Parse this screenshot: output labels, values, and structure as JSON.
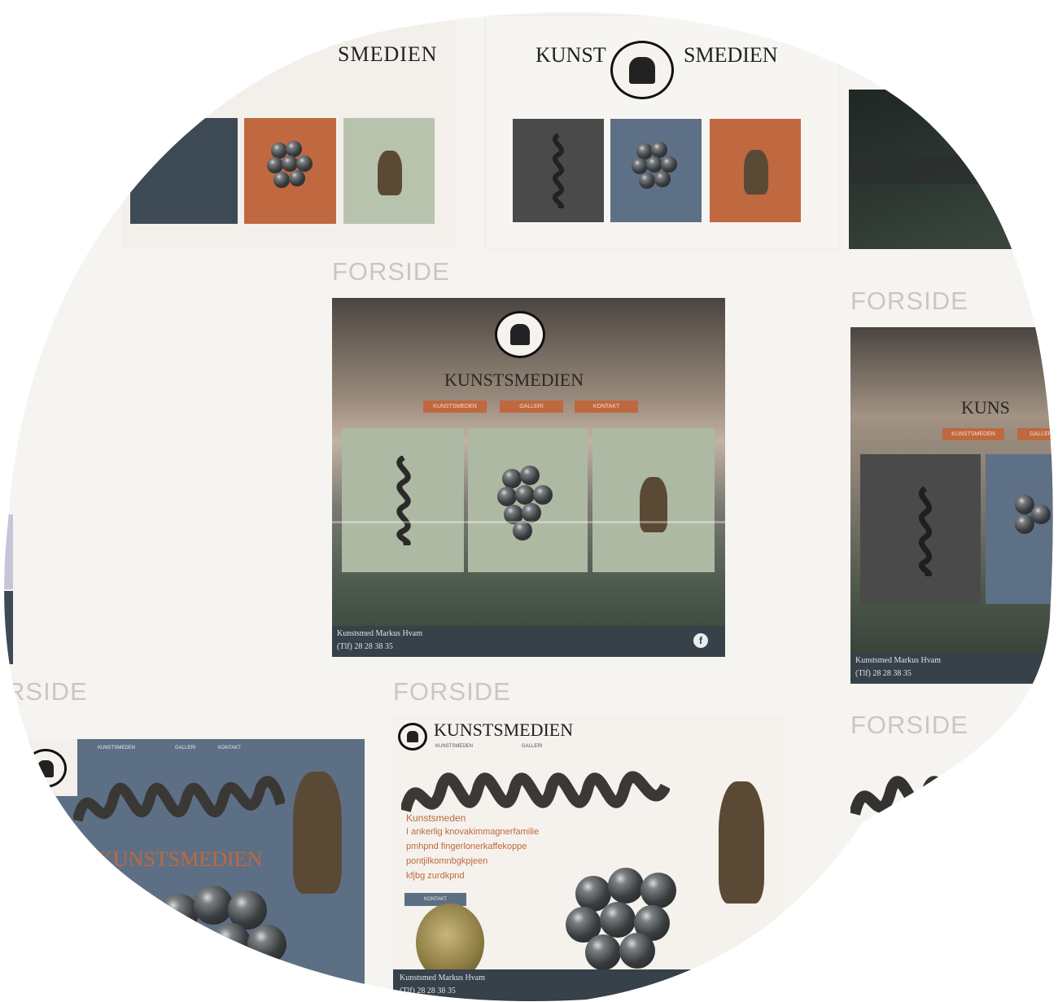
{
  "brand": {
    "name": "KUNSTSMEDIEN",
    "split_left": "KUNST",
    "split_right": "SMEDIEN",
    "partial_top_left": "SMEDIEN",
    "partial_right": "KUNS"
  },
  "labels": {
    "forside": "FORSIDE",
    "forside_cut_left": "RSIDE"
  },
  "main_mockup": {
    "buttons": [
      "KUNSTSMEDEN",
      "GALLERI",
      "KONTAKT"
    ],
    "footer_name": "Kunstsmed Markus Hvam",
    "footer_phone": "(Tlf) 28 28 38 35",
    "social_icon": "facebook-icon"
  },
  "right_mockup": {
    "footer_name": "Kunstsmed Markus Hvam",
    "footer_phone": "(Tlf) 28 28 38 35"
  },
  "bottom_left_mockup": {
    "nav": [
      "KUNSTSMEDEN",
      "GALLERI",
      "KONTAKT"
    ],
    "title": "KUNSTSMEDIEN"
  },
  "bottom_center_mockup": {
    "nav": [
      "KUNSTSMEDEN",
      "GALLERI"
    ],
    "heading": "Kunstsmeden",
    "body_lines": [
      "I ankerlig knovakimmagnerfamilie",
      "pmhpnd fingerlonerkaffekoppe",
      "pontjilkomnbgkpjeen",
      "kfjbg zurdkpnd"
    ],
    "button": "KONTAKT",
    "footer_name": "Kunstsmed Markus Hvam",
    "footer_phone": "(Tlf) 28 28 38 35"
  },
  "colors": {
    "slate": "#3e4a55",
    "rust": "#c0683f",
    "sage": "#b8c3ae",
    "charcoal": "#4a4a4a",
    "steel_blue": "#5d7085",
    "background": "#f6f4f1",
    "label_grey": "#c9c6c3"
  }
}
